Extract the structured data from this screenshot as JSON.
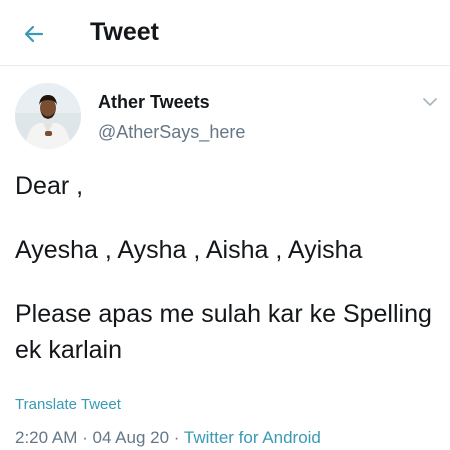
{
  "header": {
    "title": "Tweet",
    "back_icon": "arrow-left-icon"
  },
  "author": {
    "name": "Ather Tweets",
    "handle": "@AtherSays_here"
  },
  "menu": {
    "icon": "chevron-down-icon"
  },
  "tweet": {
    "lines": [
      "Dear ,",
      "Ayesha , Aysha , Aisha , Ayisha",
      "Please apas me sulah kar ke Spelling ek karlain"
    ]
  },
  "translate_label": "Translate Tweet",
  "meta": {
    "time": "2:20 AM",
    "sep1": " · ",
    "date": "04 Aug 20",
    "sep2": " · ",
    "source": "Twitter for Android"
  },
  "colors": {
    "accent": "#3a9ab4",
    "text": "#14171a",
    "muted": "#657786"
  }
}
